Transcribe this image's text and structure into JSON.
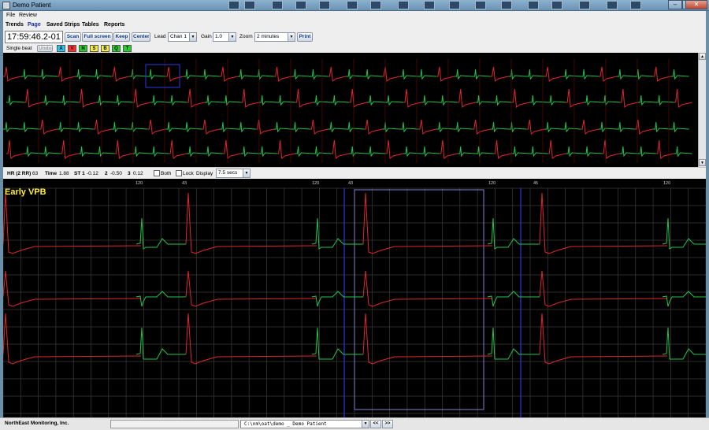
{
  "window": {
    "title": "Demo Patient",
    "minimize": "–",
    "maximize": "□",
    "close": "✕"
  },
  "menu": [
    {
      "label": "File"
    },
    {
      "label": "Review"
    }
  ],
  "tabs": [
    {
      "label": "Trends"
    },
    {
      "label": "Page"
    },
    {
      "label": "Saved Strips"
    },
    {
      "label": "Tables"
    },
    {
      "label": "Reports"
    }
  ],
  "toolbar": {
    "time": "17:59:46.2-01",
    "scan": "Scan",
    "full_screen": "Full screen",
    "keep": "Keep",
    "center": "Center",
    "lead_label": "Lead",
    "lead_value": "Chan 1",
    "gain_label": "Gain",
    "gain_value": "1.0",
    "zoom_label": "Zoom",
    "zoom_value": "2 minutes",
    "print": "Print"
  },
  "beat_row": {
    "single_beat": "Single beat",
    "undo": "Undo",
    "classes": [
      {
        "label": "A",
        "color": "#29c5ef"
      },
      {
        "label": "V",
        "color": "#ff2a2a"
      },
      {
        "label": "N",
        "color": "#22d12a"
      },
      {
        "label": "S",
        "color": "#f8f03a"
      },
      {
        "label": "B",
        "color": "#f8f03a"
      },
      {
        "label": "Q",
        "color": "#22d12a"
      },
      {
        "label": "T",
        "color": "#22d12a"
      }
    ]
  },
  "measure": {
    "hr_label": "HR (2 RR)",
    "hr_value": "63",
    "time_label": "Time",
    "time_value": "1.88",
    "st1_label": "ST 1",
    "st1_value": "-0.12",
    "ch2_label": "2",
    "ch2_value": "-0.50",
    "ch3_label": "3",
    "ch3_value": "0.12",
    "both_label": "Both",
    "lock_label": "Lock",
    "display_label": "Display",
    "display_value": "7.5 secs"
  },
  "strip": {
    "beat_label": "Early VPB",
    "intervals": [
      "120",
      "43",
      "120",
      "43",
      "120",
      "45",
      "120"
    ],
    "colors": {
      "normal": "#22c44a",
      "vpb": "#e0262c",
      "grid": "#3c3c3c",
      "marker": "#2a3ae0",
      "selection": "#7f7fd0"
    }
  },
  "status": {
    "company": "NorthEast Monitoring, Inc.",
    "path": "C:\\nm\\oat\\demo _ Demo Patient",
    "prev": "<<",
    "next": ">>"
  }
}
